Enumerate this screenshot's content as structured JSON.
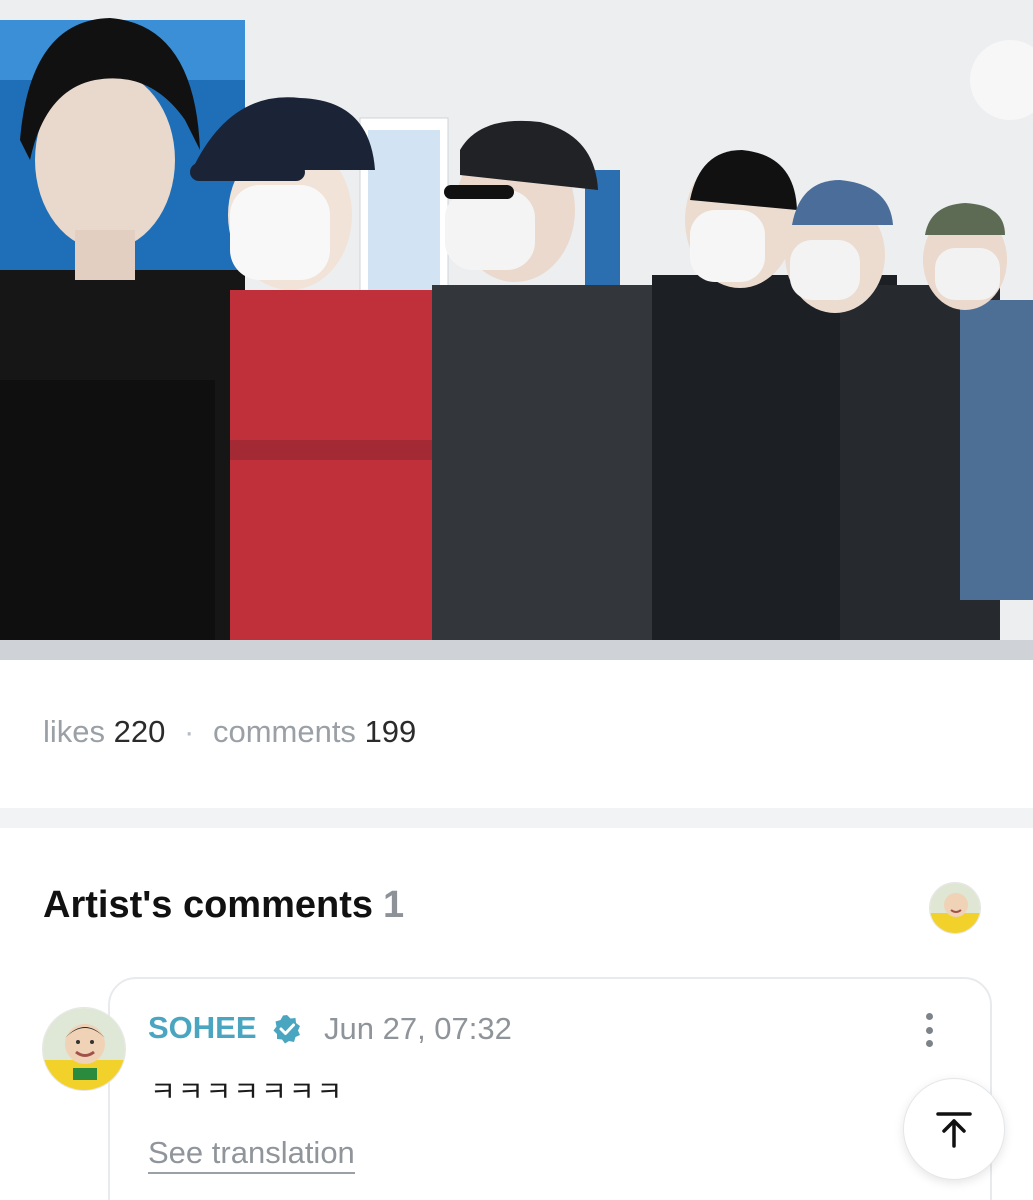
{
  "post": {
    "photo_label": "group-photo"
  },
  "stats": {
    "likes_label": "likes",
    "likes_count": "220",
    "separator": "·",
    "comments_label": "comments",
    "comments_count": "199"
  },
  "artist_comments": {
    "title": "Artist's comments",
    "count": "1"
  },
  "comment": {
    "author": "SOHEE",
    "verified_icon": "verified-badge-icon",
    "date": "Jun 27, 07:32",
    "text": "ㅋㅋㅋㅋㅋㅋㅋ",
    "translate_label": "See translation",
    "more_icon": "more-vertical-icon"
  },
  "controls": {
    "scroll_top_icon": "arrow-up-to-top-icon"
  },
  "colors": {
    "author": "#4aa6c0",
    "muted": "#9aa0a6",
    "divider": "#f2f3f5"
  }
}
